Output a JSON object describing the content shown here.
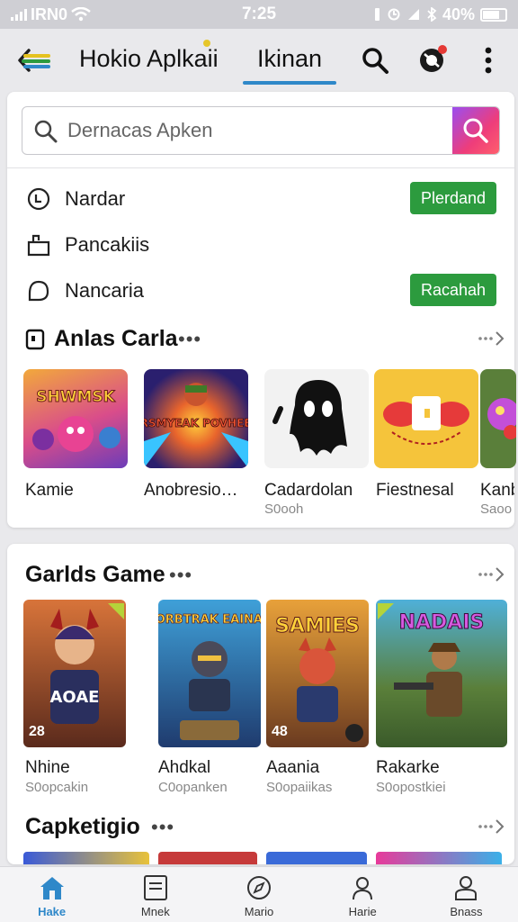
{
  "status_bar": {
    "time": "7:25",
    "carrier": "IRN0",
    "battery": "40%"
  },
  "header": {
    "title": "Hokio Aplkaii",
    "tab": "Ikinan",
    "accent": "#2f88c9"
  },
  "search": {
    "placeholder": "Dernacas Apken"
  },
  "menu": [
    {
      "label": "Nardar",
      "icon": "clock-icon",
      "action": "Plerdand"
    },
    {
      "label": "Pancakiis",
      "icon": "bag-icon",
      "action": ""
    },
    {
      "label": "Nancaria",
      "icon": "chat-icon",
      "action": "Racahah"
    }
  ],
  "section_1": {
    "title": "Anlas Carla",
    "dots": "•••",
    "apps": [
      {
        "name": "Kamie",
        "sub": "",
        "art": "SHWMSK"
      },
      {
        "name": "Anobresio…",
        "sub": "",
        "art": "BRSMYEAK POVHEEN"
      },
      {
        "name": "Cadardolan",
        "sub": "S0ooh",
        "art": ""
      },
      {
        "name": "Fiestnesal",
        "sub": "",
        "art": ""
      },
      {
        "name": "Kanb",
        "sub": "Saoo",
        "art": ""
      }
    ]
  },
  "section_2": {
    "title": "Garlds Game",
    "dots": "•••",
    "games": [
      {
        "name": "Nhine",
        "sub": "S0opcakin",
        "badge": "28",
        "art": "AOAE"
      },
      {
        "name": "Ahdkal",
        "sub": "C0opanken",
        "badge": "",
        "art": "SORBTRAK EAINAG"
      },
      {
        "name": "Aaania",
        "sub": "S0opaiikas",
        "badge": "48",
        "art": "SAMIES"
      },
      {
        "name": "Rakarke",
        "sub": "S0opostkiei",
        "badge": "",
        "art": "NADAIS"
      }
    ]
  },
  "section_3": {
    "title": "Capketigio",
    "dots": "•••"
  },
  "bottom_nav": [
    {
      "label": "Hake",
      "icon": "home-icon",
      "active": true
    },
    {
      "label": "Mnek",
      "icon": "list-icon",
      "active": false
    },
    {
      "label": "Mario",
      "icon": "compass-icon",
      "active": false
    },
    {
      "label": "Harie",
      "icon": "user-icon",
      "active": false
    },
    {
      "label": "Bnass",
      "icon": "profile-icon",
      "active": false
    }
  ]
}
